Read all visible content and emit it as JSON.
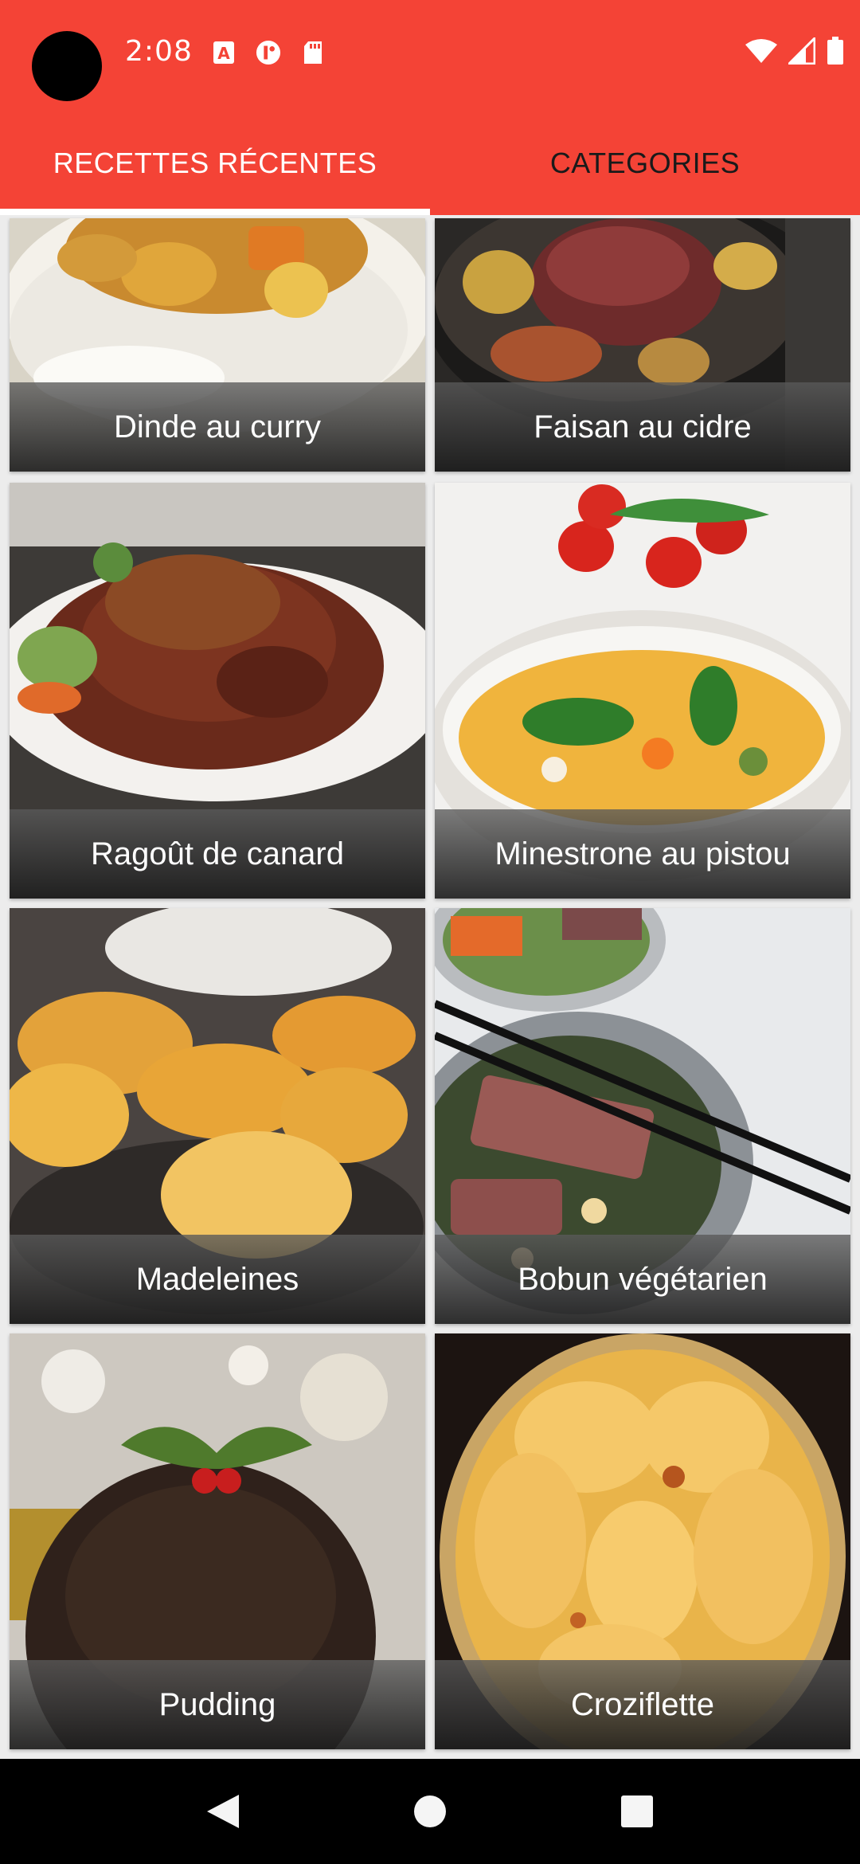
{
  "status_bar": {
    "time": "2:08",
    "notification_icons": [
      "text-a-icon",
      "alert-circle-icon",
      "sd-card-icon"
    ],
    "system_icons": [
      "wifi-icon",
      "signal-icon",
      "battery-icon"
    ]
  },
  "tabs": [
    {
      "label": "RECETTES RÉCENTES",
      "active": true
    },
    {
      "label": "CATEGORIES",
      "active": false
    }
  ],
  "recipes": [
    {
      "title": "Dinde au curry"
    },
    {
      "title": "Faisan au cidre"
    },
    {
      "title": "Ragoût de canard"
    },
    {
      "title": "Minestrone au pistou"
    },
    {
      "title": "Madeleines"
    },
    {
      "title": "Bobun végétarien"
    },
    {
      "title": "Pudding"
    },
    {
      "title": "Croziflette"
    }
  ],
  "navigation": {
    "buttons": [
      "back-icon",
      "home-icon",
      "recents-icon"
    ]
  },
  "colors": {
    "primary": "#f44336",
    "tab_active_text": "#ffffff",
    "tab_inactive_text": "#1a1a1a",
    "nav_bar": "#000000"
  }
}
